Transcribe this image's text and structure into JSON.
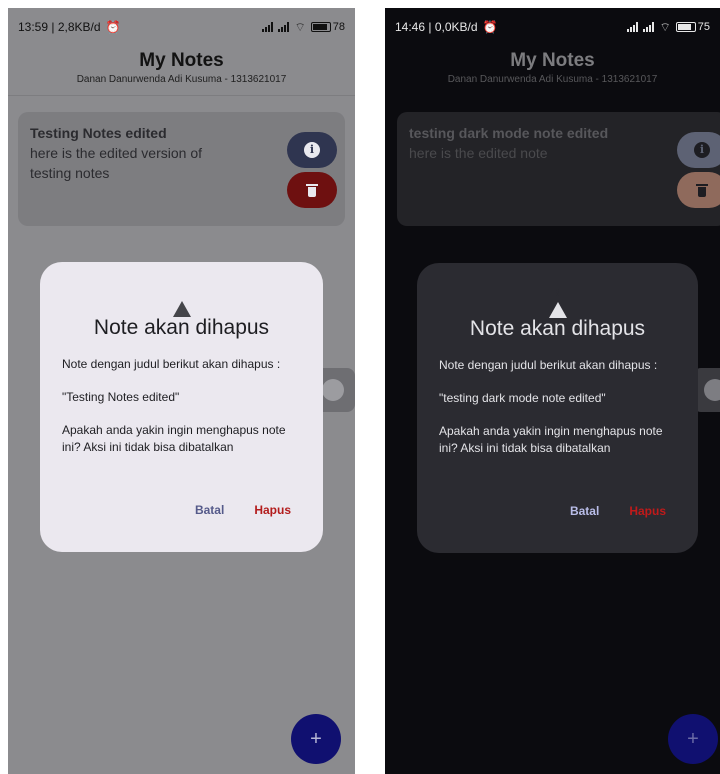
{
  "screens": [
    {
      "status": {
        "time_info": "13:59 | 2,8KB/d",
        "battery": "78",
        "battery_level": 0.78
      },
      "app": {
        "title": "My Notes",
        "subtitle": "Danan Danurwenda Adi Kusuma - 1313621017"
      },
      "note": {
        "title": "Testing Notes edited",
        "body": "here is the edited version of testing notes"
      },
      "dialog": {
        "title": "Note akan dihapus",
        "line1": "Note dengan judul berikut akan dihapus :",
        "quoted_title": "\"Testing Notes edited\"",
        "line2": "Apakah anda yakin ingin menghapus note ini? Aksi ini tidak bisa dibatalkan",
        "cancel_label": "Batal",
        "delete_label": "Hapus"
      },
      "fab_label": "+"
    },
    {
      "status": {
        "time_info": "14:46 | 0,0KB/d",
        "battery": "75",
        "battery_level": 0.75
      },
      "app": {
        "title": "My Notes",
        "subtitle": "Danan Danurwenda Adi Kusuma - 1313621017"
      },
      "note": {
        "title": "testing dark mode note edited",
        "body": "here is the edited note"
      },
      "dialog": {
        "title": "Note akan dihapus",
        "line1": "Note dengan judul berikut akan dihapus :",
        "quoted_title": "\"testing dark mode note edited\"",
        "line2": "Apakah anda yakin ingin menghapus note ini? Aksi ini tidak bisa dibatalkan",
        "cancel_label": "Batal",
        "delete_label": "Hapus"
      },
      "fab_label": "+"
    }
  ],
  "icons": [
    "alarm-icon",
    "signal-icon",
    "wifi-icon",
    "battery-icon",
    "info-icon",
    "trash-icon",
    "warning-icon",
    "plus-icon"
  ],
  "colors": {
    "info_button": "#2f3550",
    "delete_button": "#6e1010",
    "hapus_text": "#b31c1c",
    "batal_text": "#555a8a",
    "fab": "#101070"
  }
}
